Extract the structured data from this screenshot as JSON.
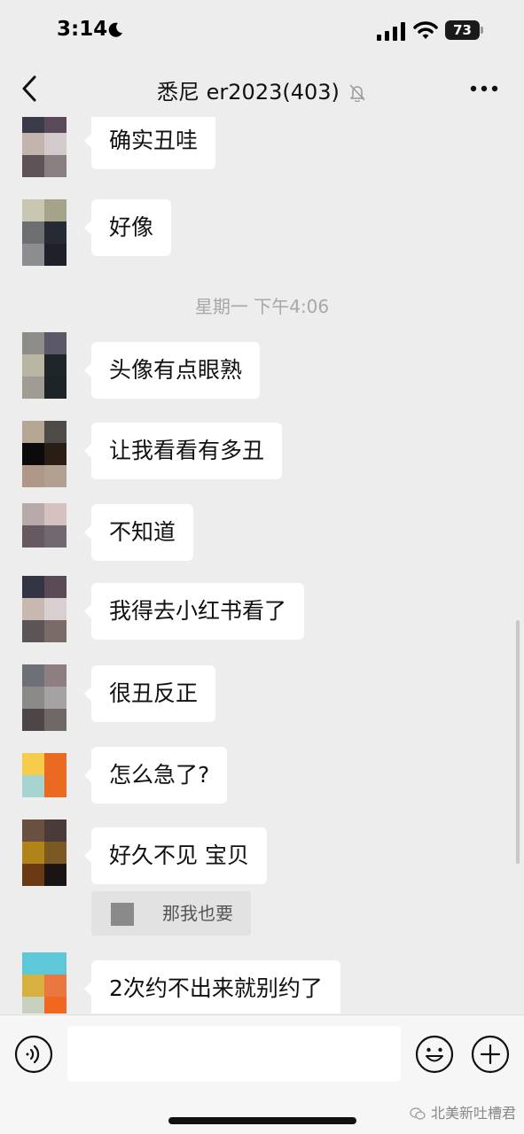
{
  "status": {
    "time": "3:14",
    "battery": "73",
    "icons": [
      "moon-icon",
      "signal-icon",
      "wifi-icon",
      "battery-icon"
    ]
  },
  "header": {
    "title": "悉尼 er2023(403)",
    "icons": [
      "back-icon",
      "mute-bell-icon",
      "more-icon"
    ]
  },
  "messages": [
    {
      "text": "确实丑哇",
      "avatar": [
        "#3a3a48",
        "#5a4a58",
        "#c4b4ae",
        "#d2cacb",
        "#5e5356",
        "#8a7f80"
      ]
    },
    {
      "text": "好像",
      "avatar": [
        "#c9c6b1",
        "#a5a48b",
        "#6d6e6f",
        "#252a33",
        "#8c8d91",
        "#20202a"
      ]
    },
    {
      "text": "头像有点眼熟",
      "avatar": [
        "#8e8c86",
        "#5a5866",
        "#b8b6a2",
        "#1f2528",
        "#9f9c93",
        "#1e2328"
      ]
    },
    {
      "text": "让我看看有多丑",
      "avatar": [
        "#b6a694",
        "#4e4a48",
        "#0d0a0c",
        "#2a1e14",
        "#b09888",
        "#b2a090"
      ]
    },
    {
      "text": "不知道",
      "avatar": [
        "#b8aaa8",
        "#d6c0c0",
        "#665a60",
        "#706a70",
        "#ededed",
        "#ededed"
      ]
    },
    {
      "text": "我得去小红书看了",
      "avatar": [
        "#343544",
        "#5a4a56",
        "#c8b8b0",
        "#d8cfd0",
        "#5d5555",
        "#7a6b68"
      ]
    },
    {
      "text": "很丑反正",
      "avatar": [
        "#6e7078",
        "#8e7e82",
        "#8c8a88",
        "#a5a2a3",
        "#4e4646",
        "#706866"
      ]
    },
    {
      "text": "怎么急了?",
      "avatar": [
        "#f7cc4a",
        "#ea6a22",
        "#a6d4d0",
        "#ea6a22",
        "#ededed",
        "#ededed"
      ]
    },
    {
      "text": "好久不见 宝贝",
      "avatar": [
        "#6a5040",
        "#4a3a38",
        "#b08418",
        "#7a5a22",
        "#6a3a12",
        "#1a1414"
      ]
    },
    {
      "text": "2次约不出来就别约了",
      "avatar": [
        "#5ec8d8",
        "#5ec8d8",
        "#d8b040",
        "#e87840",
        "#c8d0c0",
        "#f06820"
      ]
    }
  ],
  "time_separator": "星期一 下午4:06",
  "quote": {
    "text": "那我也要"
  },
  "input_bar": {
    "placeholder": "",
    "icons": [
      "voice-icon",
      "emoji-icon",
      "add-icon"
    ]
  },
  "watermark": "北美新吐槽君"
}
